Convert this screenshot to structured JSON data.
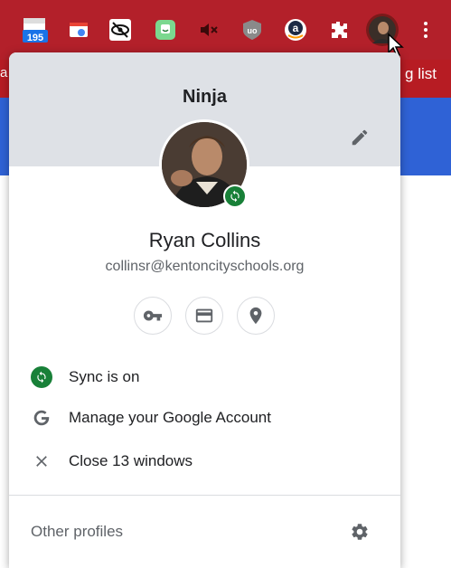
{
  "toolbar": {
    "extensions": [
      {
        "name": "calendar-extension",
        "badge": "195"
      },
      {
        "name": "window-extension"
      },
      {
        "name": "hide-eye-extension"
      },
      {
        "name": "screencastify-extension"
      },
      {
        "name": "mute-tab-extension"
      },
      {
        "name": "ublock-extension"
      },
      {
        "name": "amazon-extension"
      },
      {
        "name": "extensions-puzzle"
      }
    ],
    "bookmark_left_fragment": "a",
    "bookmark_right_fragment": "g list"
  },
  "popup": {
    "profile_name": "Ninja",
    "full_name": "Ryan Collins",
    "email": "collinsr@kentoncityschools.org",
    "menu": [
      {
        "icon": "sync-icon",
        "label": "Sync is on"
      },
      {
        "icon": "google-icon",
        "label": "Manage your Google Account"
      },
      {
        "icon": "close-icon",
        "label": "Close 13 windows"
      }
    ],
    "other_profiles_label": "Other profiles"
  },
  "colors": {
    "toolbar": "#b3202a",
    "header": "#dee1e6",
    "sync_green": "#188038",
    "icon_gray": "#5f6368"
  }
}
